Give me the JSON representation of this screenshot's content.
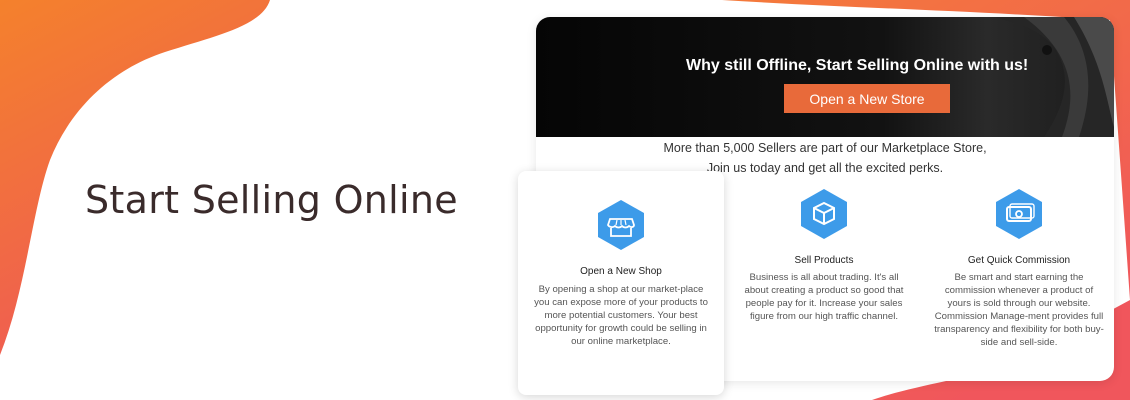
{
  "hero": {
    "title": "Start Selling Online"
  },
  "banner": {
    "headline": "Why still Offline, Start Selling Online with us!",
    "cta_label": "Open a New Store"
  },
  "intro": {
    "line1": "More than 5,000 Sellers are part of our Marketplace Store,",
    "line2": "Join us today and get all the excited perks."
  },
  "features": [
    {
      "icon": "storefront-icon",
      "title": "Open a New Shop",
      "description": "By opening a shop at our market-place you can expose more of your products to more potential customers. Your best opportunity for growth could be selling in our online marketplace."
    },
    {
      "icon": "box-icon",
      "title": "Sell Products",
      "description": "Business is all about trading. It's all about creating a product so good that people pay for it. Increase your sales figure from our high traffic channel."
    },
    {
      "icon": "money-bill-icon",
      "title": "Get Quick Commission",
      "description": "Be smart and start earning the commission whenever a product of yours is sold through our website. Commission Manage-ment provides full transparency and flexibility for both buy-side and sell-side."
    }
  ],
  "colors": {
    "accent": "#e86a3a",
    "icon_blue": "#3d9be9",
    "title_dark": "#3a2b2b",
    "gradient_orange": "#f47d2e",
    "gradient_red": "#ef5060"
  }
}
